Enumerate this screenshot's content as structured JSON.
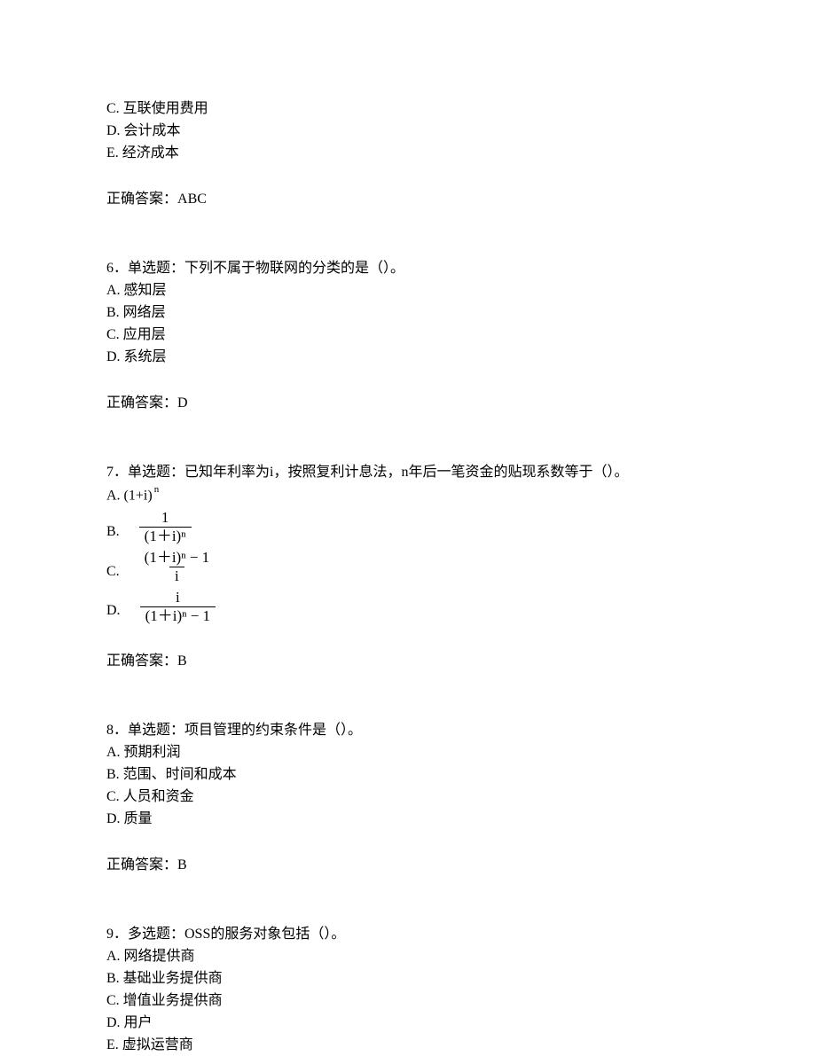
{
  "q5_partial": {
    "options": {
      "c": "C. 互联使用费用",
      "d": "D. 会计成本",
      "e": "E. 经济成本"
    },
    "answer_label": "正确答案：",
    "answer": "ABC"
  },
  "q6": {
    "stem": "6．单选题：下列不属于物联网的分类的是（）。",
    "options": {
      "a": "A. 感知层",
      "b": "B. 网络层",
      "c": "C. 应用层",
      "d": "D. 系统层"
    },
    "answer_label": "正确答案：",
    "answer": "D"
  },
  "q7": {
    "stem": "7．单选题：已知年利率为i，按照复利计息法，n年后一笔资金的贴现系数等于（）。",
    "options": {
      "a_prefix": "A. (1+i)",
      "a_sup": "n",
      "b_label": "B.",
      "b_num": "1",
      "b_den": "(1＋i)ⁿ",
      "c_label": "C.",
      "c_num": "(1＋i)ⁿ − 1",
      "c_den": "i",
      "d_label": "D.",
      "d_num": "i",
      "d_den": "(1＋i)ⁿ − 1"
    },
    "answer_label": "正确答案：",
    "answer": "B"
  },
  "q8": {
    "stem": "8．单选题：项目管理的约束条件是（）。",
    "options": {
      "a": "A. 预期利润",
      "b": "B. 范围、时间和成本",
      "c": "C. 人员和资金",
      "d": "D. 质量"
    },
    "answer_label": "正确答案：",
    "answer": "B"
  },
  "q9": {
    "stem": "9．多选题：OSS的服务对象包括（）。",
    "options": {
      "a": "A. 网络提供商",
      "b": "B. 基础业务提供商",
      "c": "C. 增值业务提供商",
      "d": "D. 用户",
      "e": "E. 虚拟运营商"
    }
  }
}
